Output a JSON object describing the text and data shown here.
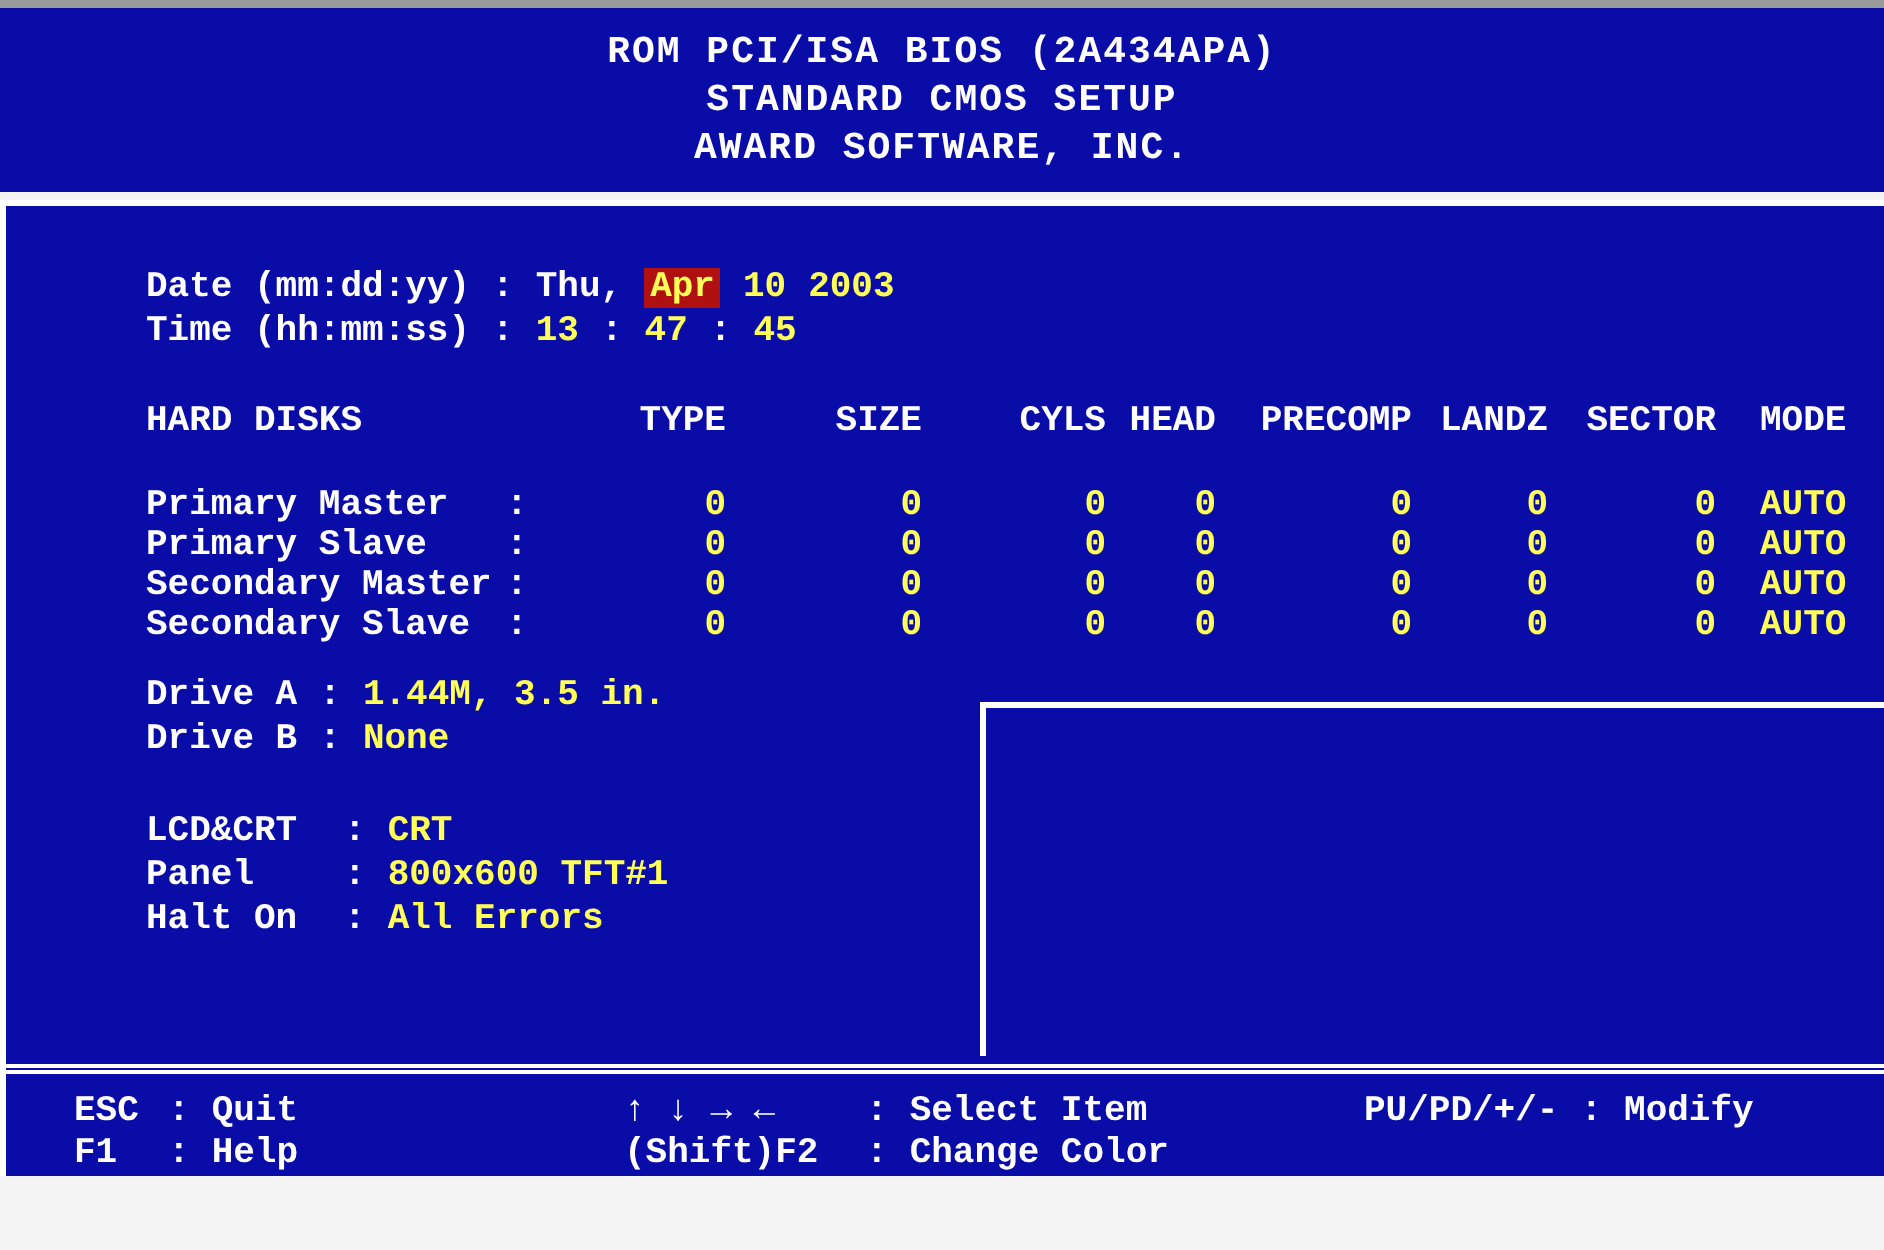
{
  "header": {
    "lines": [
      "ROM PCI/ISA BIOS (2A434APA)",
      "STANDARD CMOS SETUP",
      "AWARD SOFTWARE, INC."
    ]
  },
  "date": {
    "label": "Date (mm:dd:yy)",
    "separator": ":",
    "fields": [
      {
        "text": "Thu,",
        "kind": "fixed",
        "selected": false
      },
      {
        "text": "Apr",
        "kind": "value",
        "selected": true
      },
      {
        "text": "10",
        "kind": "value",
        "selected": false
      },
      {
        "text": "2003",
        "kind": "value",
        "selected": false
      }
    ]
  },
  "time": {
    "label": "Time (hh:mm:ss)",
    "separator": ":",
    "fields": [
      {
        "text": "13",
        "kind": "value",
        "selected": false
      },
      {
        "text": ":",
        "kind": "fixed",
        "selected": false
      },
      {
        "text": "47",
        "kind": "value",
        "selected": false
      },
      {
        "text": ":",
        "kind": "fixed",
        "selected": false
      },
      {
        "text": "45",
        "kind": "value",
        "selected": false
      }
    ]
  },
  "hard_disks": {
    "columns": [
      "HARD DISKS",
      "TYPE",
      "SIZE",
      "CYLS",
      "HEAD",
      "PRECOMP",
      "LANDZ",
      "SECTOR",
      "MODE"
    ],
    "rows": [
      {
        "name": "Primary Master",
        "separator": ":",
        "values": [
          "0",
          "0",
          "0",
          "0",
          "0",
          "0",
          "0",
          "AUTO"
        ]
      },
      {
        "name": "Primary Slave",
        "separator": ":",
        "values": [
          "0",
          "0",
          "0",
          "0",
          "0",
          "0",
          "0",
          "AUTO"
        ]
      },
      {
        "name": "Secondary Master",
        "separator": ":",
        "values": [
          "0",
          "0",
          "0",
          "0",
          "0",
          "0",
          "0",
          "AUTO"
        ]
      },
      {
        "name": "Secondary Slave",
        "separator": ":",
        "values": [
          "0",
          "0",
          "0",
          "0",
          "0",
          "0",
          "0",
          "AUTO"
        ]
      }
    ]
  },
  "settings": [
    [
      {
        "label": "Drive A",
        "separator": ":",
        "value": "1.44M, 3.5 in."
      },
      {
        "label": "Drive B",
        "separator": ":",
        "value": "None"
      }
    ],
    [
      {
        "label": "LCD&CRT",
        "separator": ":",
        "value": "CRT"
      },
      {
        "label": "Panel",
        "separator": ":",
        "value": "800x600 TFT#1"
      },
      {
        "label": "Halt On",
        "separator": ":",
        "value": "All Errors"
      }
    ]
  ],
  "footer": [
    [
      {
        "key": "ESC",
        "separator": ":",
        "action": "Quit"
      },
      {
        "key": "F1",
        "separator": ":",
        "action": "Help"
      }
    ],
    [
      {
        "key": "↑ ↓ → ←",
        "separator": ":",
        "action": "Select Item"
      },
      {
        "key": "(Shift)F2",
        "separator": ":",
        "action": "Change Color"
      }
    ],
    [
      {
        "key": "PU/PD/+/-",
        "separator": ":",
        "action": "Modify"
      }
    ]
  ]
}
